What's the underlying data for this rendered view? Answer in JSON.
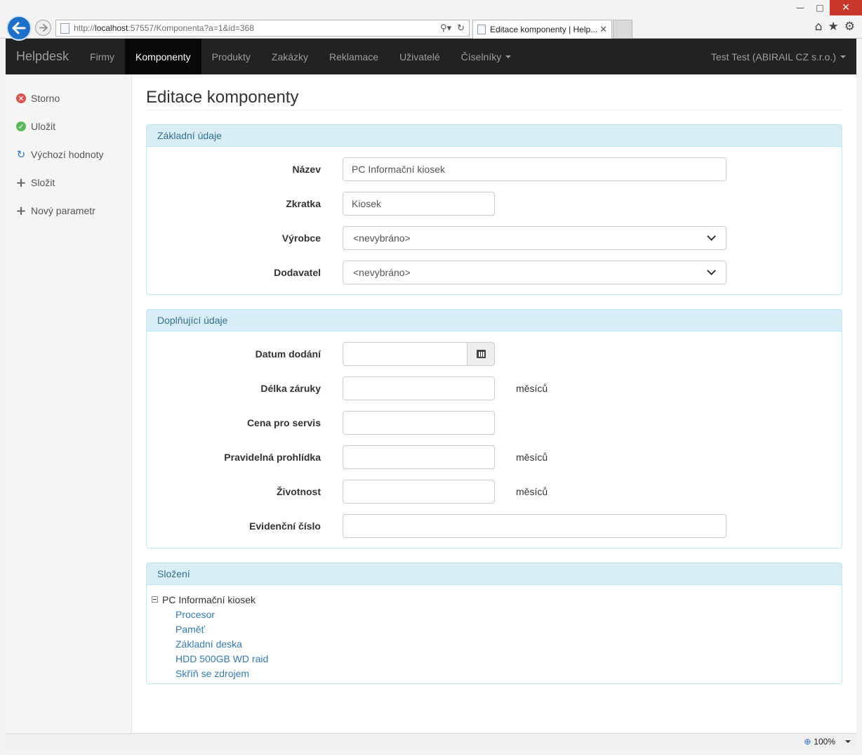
{
  "browser": {
    "url_prefix": "http://",
    "url_host": "localhost",
    "url_rest": ":57557/Komponenta?a=1&id=368",
    "tab_title": "Editace komponenty | Help...",
    "zoom": "100%"
  },
  "navbar": {
    "brand": "Helpdesk",
    "items": [
      {
        "label": "Firmy"
      },
      {
        "label": "Komponenty",
        "active": true
      },
      {
        "label": "Produkty"
      },
      {
        "label": "Zakázky"
      },
      {
        "label": "Reklamace"
      },
      {
        "label": "Uživatelé"
      },
      {
        "label": "Číselníky",
        "dropdown": true
      }
    ],
    "user": "Test Test (ABIRAIL CZ s.r.o.)"
  },
  "sidebar": {
    "items": [
      {
        "label": "Storno",
        "icon": "cancel-icon"
      },
      {
        "label": "Uložit",
        "icon": "check-icon"
      },
      {
        "label": "Výchozí hodnoty",
        "icon": "refresh-icon"
      },
      {
        "label": "Složit",
        "icon": "plus-icon"
      },
      {
        "label": "Nový parametr",
        "icon": "plus-icon"
      }
    ]
  },
  "page": {
    "title": "Editace komponenty"
  },
  "basic": {
    "heading": "Základní údaje",
    "name_label": "Název",
    "name_value": "PC Informační kiosek",
    "abbr_label": "Zkratka",
    "abbr_value": "Kiosek",
    "manufacturer_label": "Výrobce",
    "manufacturer_value": "<nevybráno>",
    "supplier_label": "Dodavatel",
    "supplier_value": "<nevybráno>"
  },
  "extra": {
    "heading": "Doplňující údaje",
    "delivery_label": "Datum dodání",
    "warranty_label": "Délka záruky",
    "warranty_unit": "měsíců",
    "price_label": "Cena pro servis",
    "inspection_label": "Pravidelná prohlídka",
    "inspection_unit": "měsíců",
    "lifetime_label": "Životnost",
    "lifetime_unit": "měsíců",
    "registry_label": "Evidenční číslo"
  },
  "composition": {
    "heading": "Složení",
    "root": "PC Informační kiosek",
    "children": [
      "Procesor",
      "Paměť",
      "Základní deska",
      "HDD 500GB WD raid",
      "Skříň se zdrojem"
    ]
  },
  "colors": {
    "navbar_bg": "#222222",
    "panel_heading_bg": "#d9edf7",
    "panel_heading_text": "#31708f",
    "link": "#337ab7"
  }
}
